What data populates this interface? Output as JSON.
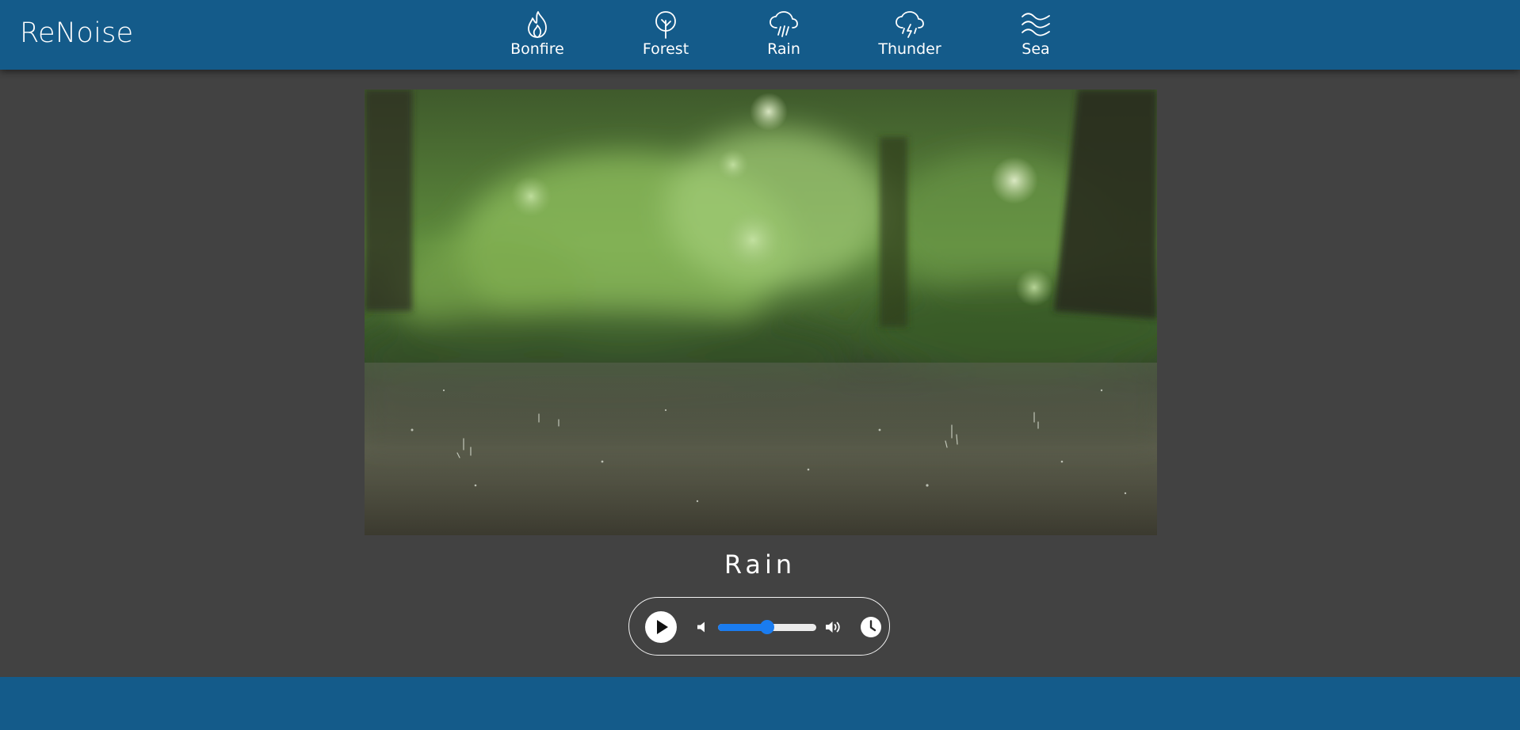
{
  "app": {
    "brand": "ReNoise"
  },
  "nav": {
    "items": [
      {
        "label": "Bonfire",
        "icon": "fire-icon"
      },
      {
        "label": "Forest",
        "icon": "tree-icon"
      },
      {
        "label": "Rain",
        "icon": "rain-cloud-icon"
      },
      {
        "label": "Thunder",
        "icon": "thunder-cloud-icon"
      },
      {
        "label": "Sea",
        "icon": "waves-icon"
      }
    ],
    "active": "Rain"
  },
  "video": {
    "subject": "rain falling on a wet path in a forest"
  },
  "player": {
    "title": "Rain",
    "state": "paused",
    "volume": 0.5,
    "accent_color": "#1a7cf0"
  },
  "colors": {
    "header": "#145b8a",
    "background": "#424242",
    "footer": "#145b8a"
  }
}
